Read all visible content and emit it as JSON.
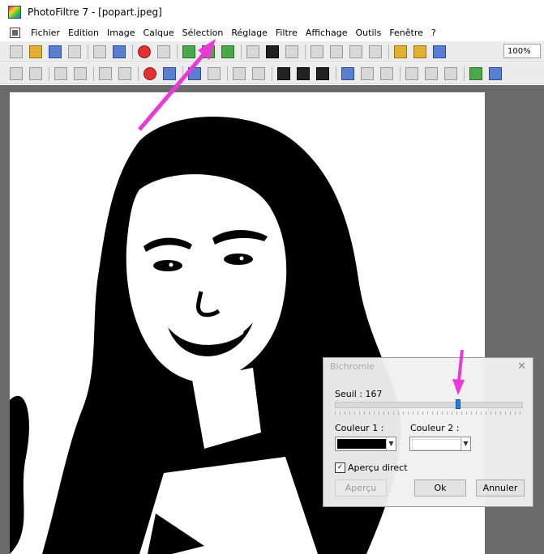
{
  "window": {
    "title": "PhotoFiltre 7 - [popart.jpeg]",
    "app_icon": "photofiltre-icon"
  },
  "menubar": {
    "items": [
      "Fichier",
      "Edition",
      "Image",
      "Calque",
      "Sélection",
      "Réglage",
      "Filtre",
      "Affichage",
      "Outils",
      "Fenêtre",
      "?"
    ]
  },
  "toolbar": {
    "zoom_value": "100%"
  },
  "dialog": {
    "title": "Bichromie",
    "seuil_label": "Seuil : 167",
    "seuil_value": 167,
    "seuil_max": 255,
    "couleur1_label": "Couleur 1 :",
    "couleur1_color": "#000000",
    "couleur2_label": "Couleur 2 :",
    "couleur2_color": "#ffffff",
    "apercu_direct_label": "Aperçu direct",
    "apercu_direct_checked": true,
    "apercu_button": "Aperçu",
    "ok_button": "Ok",
    "annuler_button": "Annuler"
  },
  "colors": {
    "annotation_arrow": "#e83ad6",
    "workspace_bg": "#6b6b6b",
    "slider_thumb": "#2b7fe0"
  }
}
